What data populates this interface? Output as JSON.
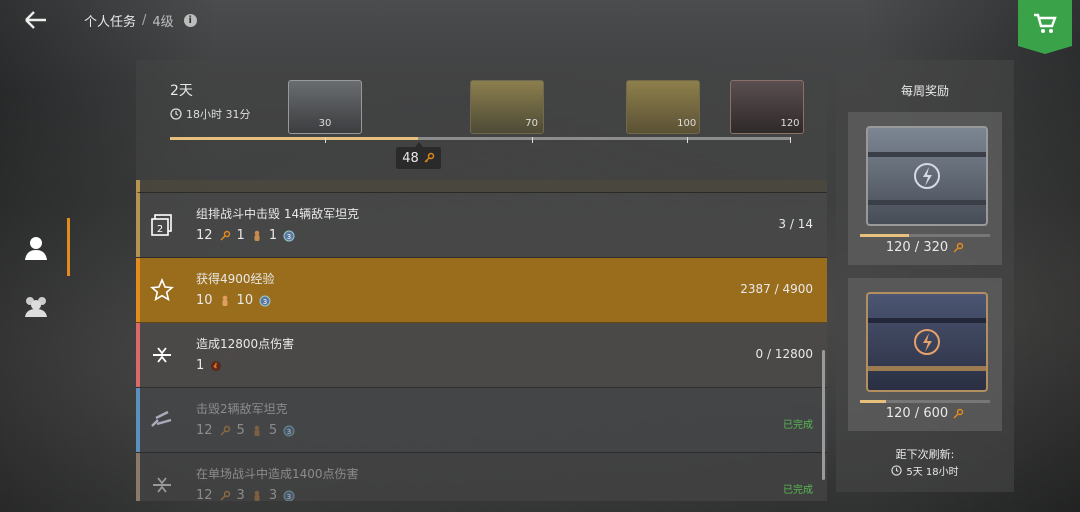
{
  "header": {
    "title": "个人任务",
    "separator": "/",
    "level": "4级"
  },
  "colors": {
    "accent": "#e38b1e",
    "gold": "#e7c07d",
    "green": "#3aa34a",
    "done": "#59b852",
    "highlight": "#a6761e"
  },
  "progress": {
    "days": "2天",
    "time_left": "18小时 31分",
    "current": "48",
    "max": 120,
    "milestones": [
      {
        "label": "30",
        "value": 30
      },
      {
        "label": "70",
        "value": 70
      },
      {
        "label": "100",
        "value": 100
      },
      {
        "label": "120",
        "value": 120
      }
    ]
  },
  "missions": [
    {
      "title": "组排战斗中击毁 14辆敌军坦克",
      "rewards": [
        "12",
        "1",
        "1"
      ],
      "progress": "3 / 14"
    },
    {
      "title": "获得4900经验",
      "rewards": [
        "10",
        "10"
      ],
      "progress": "2387 / 4900"
    },
    {
      "title": "造成12800点伤害",
      "rewards": [
        "1"
      ],
      "progress": "0 / 12800"
    },
    {
      "title": "击毁2辆敌军坦克",
      "rewards": [
        "12",
        "5",
        "5"
      ],
      "status": "已完成"
    },
    {
      "title": "在单场战斗中造成1400点伤害",
      "rewards": [
        "12",
        "3",
        "3"
      ],
      "status": "已完成"
    }
  ],
  "weekly": {
    "title": "每周奖励",
    "cards": [
      {
        "value": "120 / 320",
        "fraction": 0.375
      },
      {
        "value": "120 / 600",
        "fraction": 0.2
      }
    ],
    "refresh_label": "距下次刷新:",
    "refresh_time": "5天 18小时"
  }
}
